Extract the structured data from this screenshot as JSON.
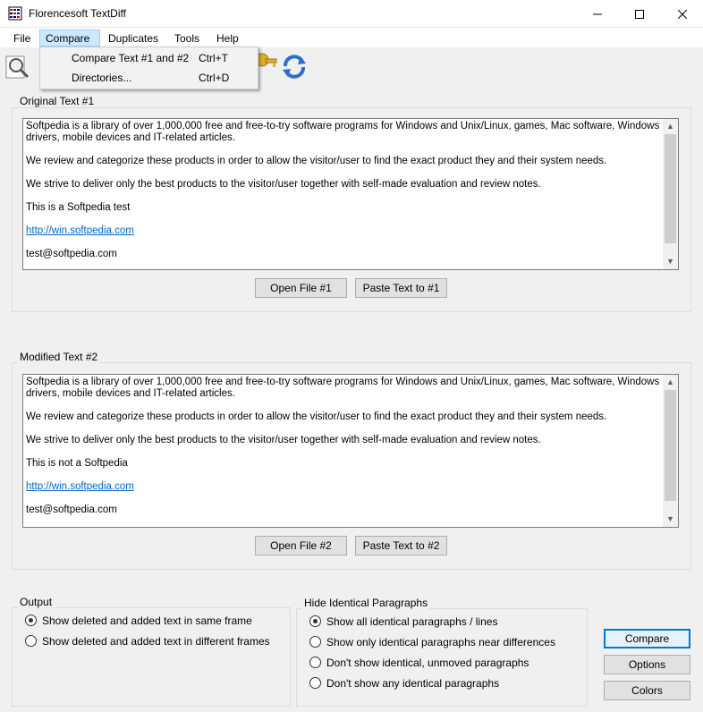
{
  "window": {
    "title": "Florencesoft TextDiff"
  },
  "menu": {
    "items": [
      {
        "label": "File"
      },
      {
        "label": "Compare"
      },
      {
        "label": "Duplicates"
      },
      {
        "label": "Tools"
      },
      {
        "label": "Help"
      }
    ]
  },
  "dropdown": {
    "items": [
      {
        "label": "Compare Text #1 and #2",
        "shortcut": "Ctrl+T"
      },
      {
        "label": "Directories...",
        "shortcut": "Ctrl+D"
      }
    ]
  },
  "original": {
    "group_title": "Original Text #1",
    "paragraphs": [
      "Softpedia is a library of over 1,000,000 free and free-to-try software programs for Windows and Unix/Linux, games, Mac software, Windows drivers, mobile devices and IT-related articles.",
      "We review and categorize these products in order to allow the visitor/user to find the exact product they and their system needs.",
      "We strive to deliver only the best products to the visitor/user together with self-made evaluation and review notes.",
      "This is a Softpedia test",
      "http://win.softpedia.com",
      "test@softpedia.com"
    ],
    "open_button": "Open File #1",
    "paste_button": "Paste Text to #1"
  },
  "modified": {
    "group_title": "Modified Text #2",
    "paragraphs": [
      "Softpedia is a library of over 1,000,000 free and free-to-try software programs for Windows and Unix/Linux, games, Mac software, Windows drivers, mobile devices and IT-related articles.",
      "We review and categorize these products in order to allow the visitor/user to find the exact product they and their system needs.",
      "We strive to deliver only the best products to the visitor/user together with self-made evaluation and review notes.",
      "This is not a Softpedia",
      "http://win.softpedia.com",
      "test@softpedia.com"
    ],
    "open_button": "Open File #2",
    "paste_button": "Paste Text to #2"
  },
  "output": {
    "group_title": "Output",
    "options": [
      {
        "label": "Show deleted and added text in same frame",
        "checked": true
      },
      {
        "label": "Show deleted and added text in different frames",
        "checked": false
      }
    ]
  },
  "hide": {
    "group_title": "Hide Identical Paragraphs",
    "options": [
      {
        "label": "Show all identical paragraphs / lines",
        "checked": true
      },
      {
        "label": "Show only identical paragraphs near differences",
        "checked": false
      },
      {
        "label": "Don't show identical, unmoved paragraphs",
        "checked": false
      },
      {
        "label": "Don't show any identical paragraphs",
        "checked": false
      }
    ]
  },
  "actions": {
    "compare": "Compare",
    "options": "Options",
    "colors": "Colors"
  },
  "colors": {
    "accent": "#0078d7",
    "link": "#0066cc"
  }
}
